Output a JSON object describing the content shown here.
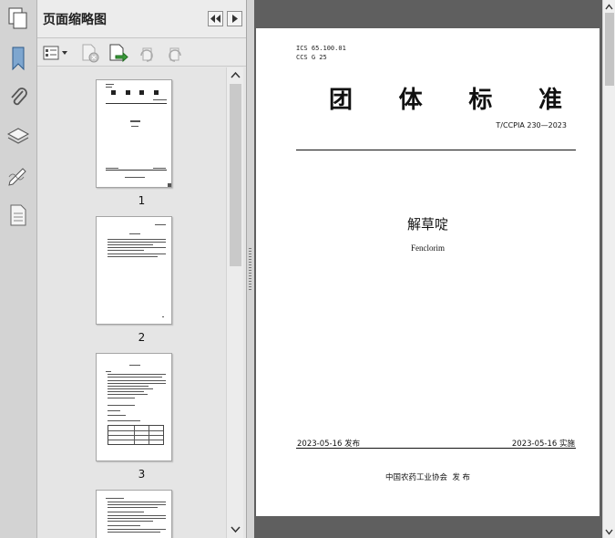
{
  "panel": {
    "title": "页面缩略图"
  },
  "thumbnails": [
    {
      "page": "1"
    },
    {
      "page": "2"
    },
    {
      "page": "3"
    }
  ],
  "document": {
    "ics": "ICS  65.100.01",
    "ccs": "CCS  G 25",
    "heading_chars": [
      "团",
      "体",
      "标",
      "准"
    ],
    "standard_no": "T/CCPIA 230—2023",
    "title_cn": "解草啶",
    "title_en": "Fenclorim",
    "issue_date": "2023-05-16 发布",
    "impl_date": "2023-05-16 实施",
    "publisher": "中国农药工业协会  发 布"
  },
  "icons": [
    "pages-icon",
    "bookmark-icon",
    "attachment-icon",
    "layers-icon",
    "signature-icon",
    "document-icon",
    "thumbnail-options-icon",
    "delete-page-icon",
    "insert-page-icon",
    "rotate-ccw-icon",
    "rotate-cw-icon",
    "collapse-left-icon",
    "collapse-right-icon"
  ],
  "colors": {
    "doc_background": "#5f5f5f",
    "panel_background": "#e7e7e7"
  }
}
